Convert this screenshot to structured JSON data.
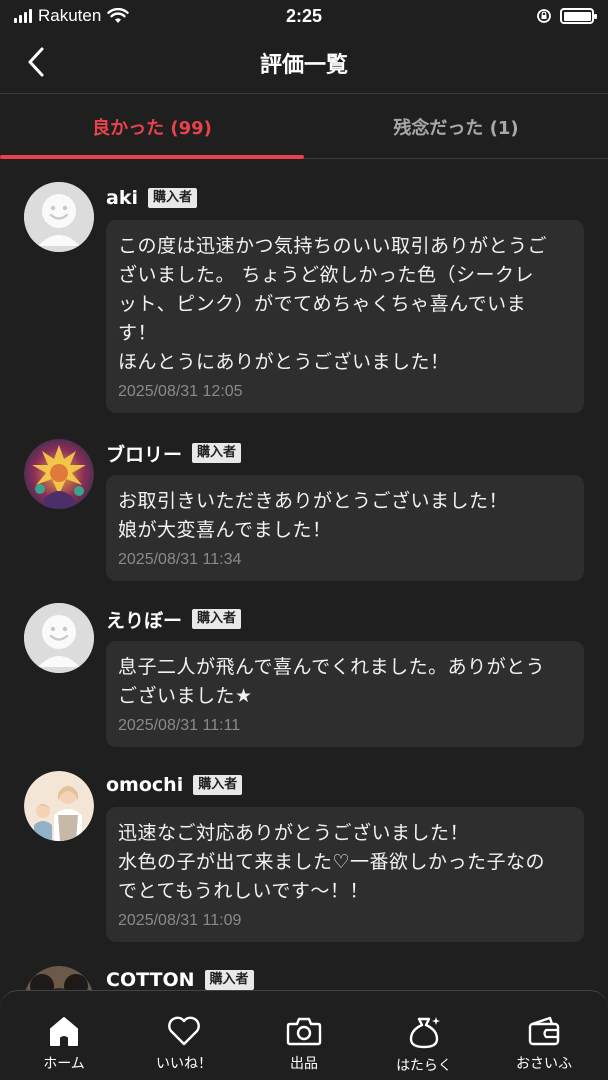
{
  "status": {
    "carrier": "Rakuten",
    "time": "2:25"
  },
  "header": {
    "title": "評価一覧"
  },
  "tabs": [
    {
      "label": "良かった (99)",
      "active": true
    },
    {
      "label": "残念だった (1)",
      "active": false
    }
  ],
  "reviews": [
    {
      "name": "aki",
      "badge": "購入者",
      "avatar": "default-face-icon",
      "comment": "この度は迅速かつ気持ちのいい取引ありがとうご\nざいました。 ちょうど欲しかった色（シークレ\nット、ピンク）がでてめちゃくちゃ喜んでいま\nす！\nほんとうにありがとうございました！",
      "date": "2025/08/31 12:05"
    },
    {
      "name": "ブロリー",
      "badge": "購入者",
      "avatar": "character-photo",
      "comment": "お取引きいただきありがとうございました！\n娘が大変喜んでました！",
      "date": "2025/08/31 11:34"
    },
    {
      "name": "えりぼー",
      "badge": "購入者",
      "avatar": "default-face-icon",
      "comment": "息子二人が飛んで喜んでくれました。ありがとう\nございました★",
      "date": "2025/08/31 11:11"
    },
    {
      "name": "omochi",
      "badge": "購入者",
      "avatar": "family-illustration",
      "comment": "迅速なご対応ありがとうございました！\n水色の子が出て来ました♡一番欲しかった子なの\nでとてもうれしいです〜！！",
      "date": "2025/08/31 11:09"
    },
    {
      "name": "COTTON",
      "badge": "購入者",
      "avatar": "mouse-photo",
      "comment": "",
      "date": ""
    }
  ],
  "tab_bar": [
    {
      "label": "ホーム",
      "icon": "home-icon"
    },
    {
      "label": "いいね！",
      "icon": "heart-icon"
    },
    {
      "label": "出品",
      "icon": "camera-icon"
    },
    {
      "label": "はたらく",
      "icon": "money-bag-icon"
    },
    {
      "label": "おさいふ",
      "icon": "wallet-icon"
    }
  ]
}
